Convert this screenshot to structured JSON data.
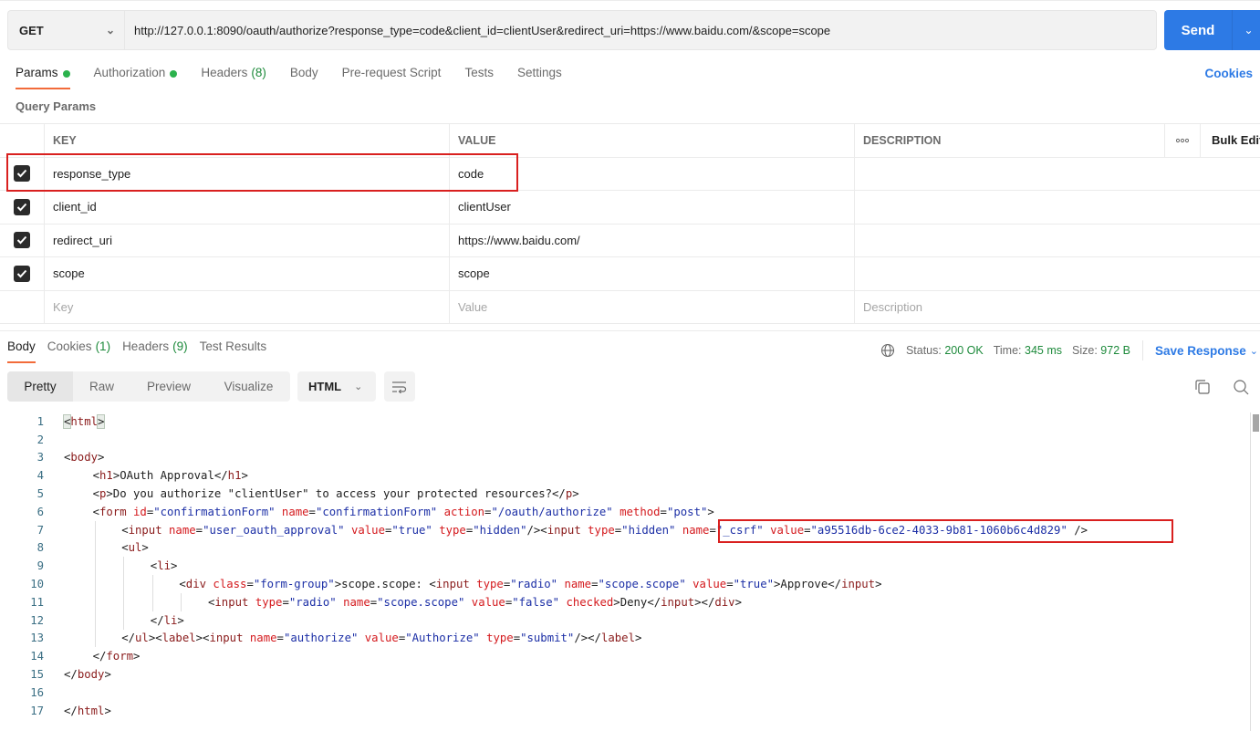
{
  "request": {
    "method": "GET",
    "url": "http://127.0.0.1:8090/oauth/authorize?response_type=code&client_id=clientUser&redirect_uri=https://www.baidu.com/&scope=scope",
    "send_label": "Send"
  },
  "request_tabs": [
    {
      "label": "Params",
      "dot": true,
      "active": true
    },
    {
      "label": "Authorization",
      "dot": true
    },
    {
      "label": "Headers",
      "count": "(8)"
    },
    {
      "label": "Body"
    },
    {
      "label": "Pre-request Script"
    },
    {
      "label": "Tests"
    },
    {
      "label": "Settings"
    }
  ],
  "cookies_link": "Cookies",
  "query_params": {
    "title": "Query Params",
    "headers": {
      "key": "KEY",
      "value": "VALUE",
      "description": "DESCRIPTION",
      "more": "ooo",
      "bulk_edit": "Bulk Edit"
    },
    "rows": [
      {
        "checked": true,
        "key": "response_type",
        "value": "code",
        "description": ""
      },
      {
        "checked": true,
        "key": "client_id",
        "value": "clientUser",
        "description": ""
      },
      {
        "checked": true,
        "key": "redirect_uri",
        "value": "https://www.baidu.com/",
        "description": ""
      },
      {
        "checked": true,
        "key": "scope",
        "value": "scope",
        "description": ""
      }
    ],
    "placeholders": {
      "key": "Key",
      "value": "Value",
      "description": "Description"
    }
  },
  "response_tabs": [
    {
      "label": "Body",
      "active": true
    },
    {
      "label": "Cookies",
      "count": "(1)"
    },
    {
      "label": "Headers",
      "count": "(9)"
    },
    {
      "label": "Test Results"
    }
  ],
  "response_meta": {
    "status_label": "Status:",
    "status": "200 OK",
    "time_label": "Time:",
    "time": "345 ms",
    "size_label": "Size:",
    "size": "972 B",
    "save_label": "Save Response"
  },
  "format": {
    "options": [
      "Pretty",
      "Raw",
      "Preview",
      "Visualize"
    ],
    "active": "Pretty",
    "language": "HTML"
  },
  "code_lines": [
    {
      "n": "1",
      "tokens": [
        [
          "bh",
          "<html>"
        ]
      ]
    },
    {
      "n": "2",
      "tokens": []
    },
    {
      "n": "3",
      "tokens": [
        [
          "p",
          "<"
        ],
        [
          "t",
          "body"
        ],
        [
          "p",
          ">"
        ]
      ]
    },
    {
      "n": "4",
      "indent": 1,
      "tokens": [
        [
          "p",
          "<"
        ],
        [
          "t",
          "h1"
        ],
        [
          "p",
          ">OAuth Approval</"
        ],
        [
          "t",
          "h1"
        ],
        [
          "p",
          ">"
        ]
      ]
    },
    {
      "n": "5",
      "indent": 1,
      "tokens": [
        [
          "p",
          "<"
        ],
        [
          "t",
          "p"
        ],
        [
          "p",
          ">Do you authorize \"clientUser\" to access your protected resources?</"
        ],
        [
          "t",
          "p"
        ],
        [
          "p",
          ">"
        ]
      ]
    },
    {
      "n": "6",
      "indent": 1,
      "tokens": [
        [
          "p",
          "<"
        ],
        [
          "t",
          "form"
        ],
        [
          "p",
          " "
        ],
        [
          "a",
          "id"
        ],
        [
          "p",
          "="
        ],
        [
          "v",
          "\"confirmationForm\""
        ],
        [
          "p",
          " "
        ],
        [
          "a",
          "name"
        ],
        [
          "p",
          "="
        ],
        [
          "v",
          "\"confirmationForm\""
        ],
        [
          "p",
          " "
        ],
        [
          "a",
          "action"
        ],
        [
          "p",
          "="
        ],
        [
          "v",
          "\"/oauth/authorize\""
        ],
        [
          "p",
          " "
        ],
        [
          "a",
          "method"
        ],
        [
          "p",
          "="
        ],
        [
          "v",
          "\"post\""
        ],
        [
          "p",
          ">"
        ]
      ]
    },
    {
      "n": "7",
      "indent": 2,
      "tokens": [
        [
          "p",
          "<"
        ],
        [
          "t",
          "input"
        ],
        [
          "p",
          " "
        ],
        [
          "a",
          "name"
        ],
        [
          "p",
          "="
        ],
        [
          "v",
          "\"user_oauth_approval\""
        ],
        [
          "p",
          " "
        ],
        [
          "a",
          "value"
        ],
        [
          "p",
          "="
        ],
        [
          "v",
          "\"true\""
        ],
        [
          "p",
          " "
        ],
        [
          "a",
          "type"
        ],
        [
          "p",
          "="
        ],
        [
          "v",
          "\"hidden\""
        ],
        [
          "p",
          "/><"
        ],
        [
          "t",
          "input"
        ],
        [
          "p",
          " "
        ],
        [
          "a",
          "type"
        ],
        [
          "p",
          "="
        ],
        [
          "v",
          "\"hidden\""
        ],
        [
          "p",
          " "
        ],
        [
          "a",
          "name"
        ],
        [
          "p",
          "="
        ],
        [
          "v",
          "\"_csrf\""
        ],
        [
          "p",
          " "
        ],
        [
          "a",
          "value"
        ],
        [
          "p",
          "="
        ],
        [
          "v",
          "\"a95516db-6ce2-4033-9b81-1060b6c4d829\""
        ],
        [
          "p",
          " />"
        ]
      ]
    },
    {
      "n": "8",
      "indent": 2,
      "tokens": [
        [
          "p",
          "<"
        ],
        [
          "t",
          "ul"
        ],
        [
          "p",
          ">"
        ]
      ]
    },
    {
      "n": "9",
      "indent": 3,
      "tokens": [
        [
          "p",
          "<"
        ],
        [
          "t",
          "li"
        ],
        [
          "p",
          ">"
        ]
      ]
    },
    {
      "n": "10",
      "indent": 4,
      "tokens": [
        [
          "p",
          "<"
        ],
        [
          "t",
          "div"
        ],
        [
          "p",
          " "
        ],
        [
          "a",
          "class"
        ],
        [
          "p",
          "="
        ],
        [
          "v",
          "\"form-group\""
        ],
        [
          "p",
          ">scope.scope: <"
        ],
        [
          "t",
          "input"
        ],
        [
          "p",
          " "
        ],
        [
          "a",
          "type"
        ],
        [
          "p",
          "="
        ],
        [
          "v",
          "\"radio\""
        ],
        [
          "p",
          " "
        ],
        [
          "a",
          "name"
        ],
        [
          "p",
          "="
        ],
        [
          "v",
          "\"scope.scope\""
        ],
        [
          "p",
          " "
        ],
        [
          "a",
          "value"
        ],
        [
          "p",
          "="
        ],
        [
          "v",
          "\"true\""
        ],
        [
          "p",
          ">Approve</"
        ],
        [
          "t",
          "input"
        ],
        [
          "p",
          ">"
        ]
      ]
    },
    {
      "n": "11",
      "indent": 5,
      "tokens": [
        [
          "p",
          "<"
        ],
        [
          "t",
          "input"
        ],
        [
          "p",
          " "
        ],
        [
          "a",
          "type"
        ],
        [
          "p",
          "="
        ],
        [
          "v",
          "\"radio\""
        ],
        [
          "p",
          " "
        ],
        [
          "a",
          "name"
        ],
        [
          "p",
          "="
        ],
        [
          "v",
          "\"scope.scope\""
        ],
        [
          "p",
          " "
        ],
        [
          "a",
          "value"
        ],
        [
          "p",
          "="
        ],
        [
          "v",
          "\"false\""
        ],
        [
          "p",
          " "
        ],
        [
          "a",
          "checked"
        ],
        [
          "p",
          ">Deny</"
        ],
        [
          "t",
          "input"
        ],
        [
          "p",
          "></"
        ],
        [
          "t",
          "div"
        ],
        [
          "p",
          ">"
        ]
      ]
    },
    {
      "n": "12",
      "indent": 3,
      "tokens": [
        [
          "p",
          "</"
        ],
        [
          "t",
          "li"
        ],
        [
          "p",
          ">"
        ]
      ]
    },
    {
      "n": "13",
      "indent": 2,
      "tokens": [
        [
          "p",
          "</"
        ],
        [
          "t",
          "ul"
        ],
        [
          "p",
          "><"
        ],
        [
          "t",
          "label"
        ],
        [
          "p",
          "><"
        ],
        [
          "t",
          "input"
        ],
        [
          "p",
          " "
        ],
        [
          "a",
          "name"
        ],
        [
          "p",
          "="
        ],
        [
          "v",
          "\"authorize\""
        ],
        [
          "p",
          " "
        ],
        [
          "a",
          "value"
        ],
        [
          "p",
          "="
        ],
        [
          "v",
          "\"Authorize\""
        ],
        [
          "p",
          " "
        ],
        [
          "a",
          "type"
        ],
        [
          "p",
          "="
        ],
        [
          "v",
          "\"submit\""
        ],
        [
          "p",
          "/></"
        ],
        [
          "t",
          "label"
        ],
        [
          "p",
          ">"
        ]
      ]
    },
    {
      "n": "14",
      "indent": 1,
      "tokens": [
        [
          "p",
          "</"
        ],
        [
          "t",
          "form"
        ],
        [
          "p",
          ">"
        ]
      ]
    },
    {
      "n": "15",
      "tokens": [
        [
          "p",
          "</"
        ],
        [
          "t",
          "body"
        ],
        [
          "p",
          ">"
        ]
      ]
    },
    {
      "n": "16",
      "tokens": []
    },
    {
      "n": "17",
      "tokens": [
        [
          "p",
          "</"
        ],
        [
          "t",
          "html"
        ],
        [
          "p",
          ">"
        ]
      ]
    }
  ],
  "colors": {
    "accent": "#2d7ae5",
    "active_tab_underline": "#f26b3a",
    "success": "#1d8a3b",
    "annotation_box": "#d9201f"
  }
}
